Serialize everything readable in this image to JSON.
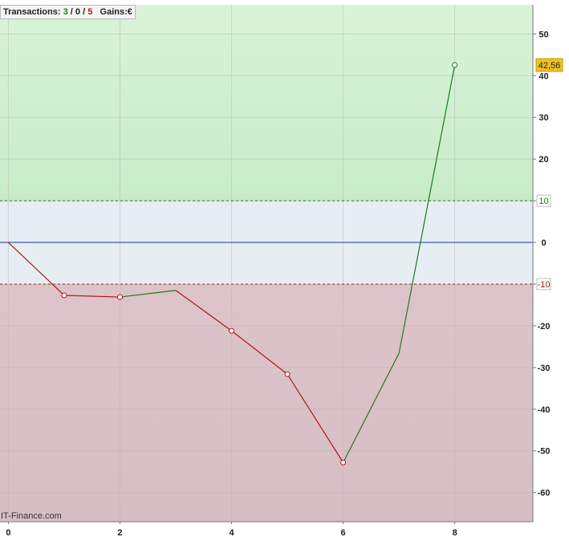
{
  "header": {
    "transactions_label": "Transactions:",
    "wins": "3",
    "sep1": "/",
    "neutral": "0",
    "sep2": "/",
    "losses": "5",
    "gains_label": "Gains:",
    "gains_unit": "€"
  },
  "watermark": "IT-Finance.com",
  "colors": {
    "win": "#1f7a1f",
    "loss": "#b01818",
    "zero_line": "#1a2fb0",
    "profit_zone": "#c8ecc8",
    "neutral_zone": "#e6eef3",
    "loss_zone": "#d7bec4",
    "last_value_badge": "#f0c020"
  },
  "chart_data": {
    "type": "line",
    "x": [
      0,
      1,
      2,
      3,
      4,
      5,
      6,
      7,
      8
    ],
    "y": [
      0,
      -12.7,
      -13.1,
      -11.5,
      -21.2,
      -31.6,
      -52.8,
      -26.6,
      42.56
    ],
    "segment_colors": [
      "loss",
      "loss",
      "win",
      "loss",
      "loss",
      "loss",
      "win",
      "win"
    ],
    "markers_at": [
      1,
      2,
      4,
      5,
      6,
      8
    ],
    "xticks": [
      0,
      2,
      4,
      6,
      8
    ],
    "xtick_labels": [
      "0",
      "2",
      "4",
      "6",
      "8"
    ],
    "yticks": [
      50,
      40,
      30,
      20,
      10,
      0,
      -10,
      -20,
      -30,
      -40,
      -50,
      -60
    ],
    "ytick_labels": [
      "50",
      "40",
      "30",
      "20",
      "10",
      "0",
      "-10",
      "-20",
      "-30",
      "-40",
      "-50",
      "-60"
    ],
    "boxed_ticks": [
      10,
      -10
    ],
    "xlim": [
      -0.15,
      9.4
    ],
    "ylim": [
      -67,
      57
    ],
    "thresholds": {
      "upper": 10,
      "lower": -10
    },
    "last_value_label": "42,56",
    "grid": true
  }
}
